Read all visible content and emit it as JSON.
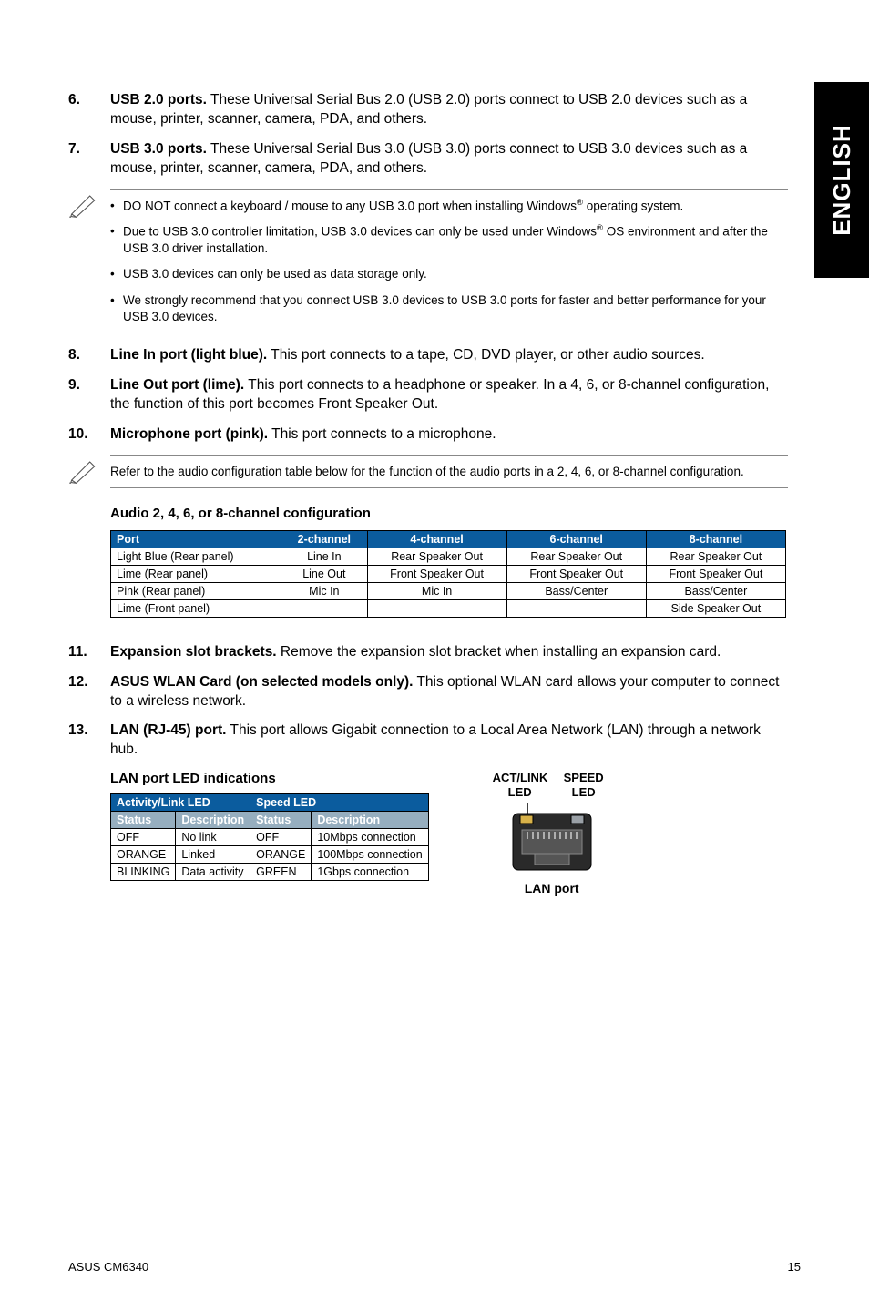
{
  "side_tab": "ENGLISH",
  "items": {
    "i6": {
      "num": "6.",
      "lead": "USB 2.0 ports.",
      "text": " These Universal Serial Bus 2.0 (USB 2.0) ports connect to USB 2.0 devices such as a mouse, printer, scanner, camera, PDA, and others."
    },
    "i7": {
      "num": "7.",
      "lead": "USB 3.0 ports.",
      "text": " These Universal Serial Bus 3.0 (USB 3.0) ports connect to USB 3.0 devices such as a mouse, printer, scanner, camera, PDA, and others."
    },
    "i8": {
      "num": "8.",
      "lead": "Line In port (light blue).",
      "text": " This port connects to a tape, CD, DVD player, or other audio sources."
    },
    "i9": {
      "num": "9.",
      "lead": "Line Out port (lime).",
      "text": " This port connects to a headphone or speaker. In a 4, 6, or 8-channel configuration, the function of this port becomes Front Speaker Out."
    },
    "i10": {
      "num": "10.",
      "lead": "Microphone port (pink).",
      "text": " This port connects to a microphone."
    },
    "i11": {
      "num": "11.",
      "lead": "Expansion slot brackets.",
      "text": " Remove the expansion slot bracket when installing an expansion card."
    },
    "i12": {
      "num": "12.",
      "lead": "ASUS WLAN Card (on selected models only).",
      "text": " This optional WLAN card allows your computer to connect to a wireless network."
    },
    "i13": {
      "num": "13.",
      "lead": "LAN (RJ-45) port.",
      "text": " This port allows Gigabit connection to a Local Area Network (LAN) through a network hub."
    }
  },
  "note1": {
    "b1a": "DO NOT connect a keyboard / mouse to any USB 3.0 port when installing Windows",
    "b1b": " operating system.",
    "b2a": "Due to USB 3.0 controller limitation, USB 3.0 devices can only be used under Windows",
    "b2b": " OS environment and after the USB 3.0 driver installation.",
    "b3": "USB 3.0 devices can only be used as data storage only.",
    "b4": "We strongly recommend that you connect USB 3.0 devices to USB 3.0 ports for faster and better performance for your USB 3.0 devices."
  },
  "note2": "Refer to the audio configuration table below for the function of the audio ports in a 2, 4, 6, or 8-channel configuration.",
  "audio_head": "Audio 2, 4, 6, or 8-channel configuration",
  "chart_data": [
    {
      "type": "table",
      "title": "Audio 2, 4, 6, or 8-channel configuration",
      "columns": [
        "Port",
        "2-channel",
        "4-channel",
        "6-channel",
        "8-channel"
      ],
      "rows": [
        [
          "Light Blue (Rear panel)",
          "Line In",
          "Rear Speaker Out",
          "Rear Speaker Out",
          "Rear Speaker Out"
        ],
        [
          "Lime (Rear panel)",
          "Line Out",
          "Front Speaker Out",
          "Front Speaker Out",
          "Front Speaker Out"
        ],
        [
          "Pink (Rear panel)",
          "Mic In",
          "Mic In",
          "Bass/Center",
          "Bass/Center"
        ],
        [
          "Lime (Front panel)",
          "–",
          "–",
          "–",
          "Side Speaker Out"
        ]
      ]
    },
    {
      "type": "table",
      "title": "LAN port LED indications",
      "groups": [
        "Activity/Link LED",
        "Speed LED"
      ],
      "columns": [
        "Status",
        "Description",
        "Status",
        "Description"
      ],
      "rows": [
        [
          "OFF",
          "No link",
          "OFF",
          "10Mbps connection"
        ],
        [
          "ORANGE",
          "Linked",
          "ORANGE",
          "100Mbps connection"
        ],
        [
          "BLINKING",
          "Data activity",
          "GREEN",
          "1Gbps connection"
        ]
      ]
    }
  ],
  "audio": {
    "h_port": "Port",
    "h_2": "2-channel",
    "h_4": "4-channel",
    "h_6": "6-channel",
    "h_8": "8-channel",
    "r1c1": "Light Blue (Rear panel)",
    "r1c2": "Line In",
    "r1c3": "Rear Speaker Out",
    "r1c4": "Rear Speaker Out",
    "r1c5": "Rear Speaker Out",
    "r2c1": "Lime (Rear panel)",
    "r2c2": "Line Out",
    "r2c3": "Front Speaker Out",
    "r2c4": "Front Speaker Out",
    "r2c5": "Front Speaker Out",
    "r3c1": "Pink (Rear panel)",
    "r3c2": "Mic In",
    "r3c3": "Mic In",
    "r3c4": "Bass/Center",
    "r3c5": "Bass/Center",
    "r4c1": "Lime (Front panel)",
    "r4c2": "–",
    "r4c3": "–",
    "r4c4": "–",
    "r4c5": "Side Speaker Out"
  },
  "lan_head": "LAN port LED indications",
  "lan": {
    "g1": "Activity/Link LED",
    "g2": "Speed LED",
    "s1": "Status",
    "s2": "Description",
    "s3": "Status",
    "s4": "Description",
    "r1c1": "OFF",
    "r1c2": "No link",
    "r1c3": "OFF",
    "r1c4": "10Mbps connection",
    "r2c1": "ORANGE",
    "r2c2": "Linked",
    "r2c3": "ORANGE",
    "r2c4": "100Mbps connection",
    "r3c1": "BLINKING",
    "r3c2": "Data activity",
    "r3c3": "GREEN",
    "r3c4": "1Gbps connection"
  },
  "lan_diagram": {
    "act": "ACT/LINK LED",
    "speed": "SPEED LED",
    "port": "LAN port"
  },
  "footer": {
    "left": "ASUS CM6340",
    "right": "15"
  }
}
